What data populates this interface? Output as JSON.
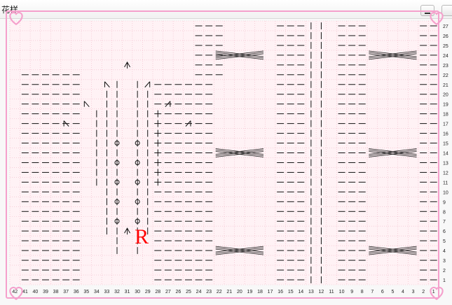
{
  "window": {
    "title": "花样",
    "minimize_icon": "minimize-icon",
    "second_button_icon": "window-button-icon"
  },
  "chart": {
    "row_numbers": [
      "1",
      "2",
      "3",
      "4",
      "5",
      "6",
      "7",
      "8",
      "9",
      "10",
      "11",
      "12",
      "13",
      "14",
      "15",
      "16",
      "17",
      "18",
      "19",
      "20",
      "21",
      "22",
      "23",
      "24",
      "25",
      "26",
      "27"
    ],
    "column_numbers": [
      "42",
      "41",
      "40",
      "39",
      "38",
      "37",
      "36",
      "35",
      "34",
      "33",
      "32",
      "31",
      "30",
      "29",
      "28",
      "27",
      "26",
      "25",
      "24",
      "23",
      "22",
      "21",
      "20",
      "19",
      "18",
      "17",
      "16",
      "15",
      "14",
      "13",
      "12",
      "11",
      "10",
      "9",
      "8",
      "7",
      "6",
      "5",
      "4",
      "3",
      "2",
      "1"
    ],
    "marker_label": "R",
    "cable_rows": [
      "4",
      "14",
      "24"
    ],
    "colors": {
      "grid_background": "#fff2f5",
      "grid_line": "#f2b8c7",
      "frame": "#f5a0cc",
      "symbol": "#111111",
      "marker": "#ff0000"
    },
    "corner_icons": [
      "heart-icon",
      "heart-icon",
      "heart-icon",
      "heart-icon"
    ]
  }
}
